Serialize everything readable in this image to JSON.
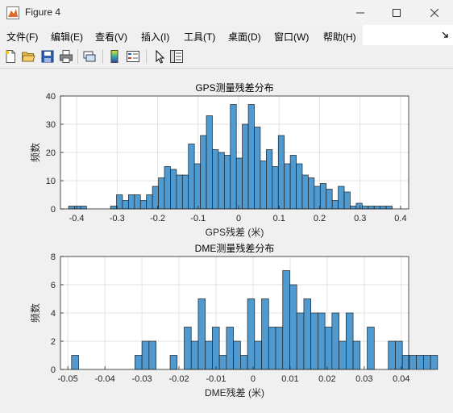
{
  "window": {
    "title": "Figure 4"
  },
  "menu": [
    "文件(F)",
    "编辑(E)",
    "查看(V)",
    "插入(I)",
    "工具(T)",
    "桌面(D)",
    "窗口(W)",
    "帮助(H)"
  ],
  "toolbar": [
    {
      "name": "new-figure-icon"
    },
    {
      "name": "open-file-icon"
    },
    {
      "name": "save-icon"
    },
    {
      "name": "print-icon"
    },
    {
      "name": "link-plot-icon"
    },
    {
      "name": "colorbar-icon"
    },
    {
      "name": "legend-icon"
    },
    {
      "name": "pointer-icon"
    },
    {
      "name": "property-inspector-icon"
    }
  ],
  "colors": {
    "bar_fill": "#4f9bd1",
    "bar_edge": "#1f1f1f",
    "grid": "#e3e3e3",
    "axes": "#262626"
  },
  "chart_data": [
    {
      "type": "bar",
      "title": "GPS测量残差分布",
      "xlabel": "GPS残差 (米)",
      "ylabel": "频数",
      "xlim": [
        -0.44,
        0.42
      ],
      "ylim": [
        0,
        40
      ],
      "grid": true,
      "xticks": [
        "-0.4",
        "-0.3",
        "-0.2",
        "-0.1",
        "0",
        "0.1",
        "0.2",
        "0.3",
        "0.4"
      ],
      "yticks": [
        "0",
        "10",
        "20",
        "30",
        "40"
      ],
      "bin_start": -0.42,
      "bin_width": 0.0148,
      "values": [
        1,
        1,
        1,
        0,
        0,
        0,
        0,
        1,
        5,
        3,
        5,
        5,
        3,
        5,
        8,
        11,
        15,
        14,
        12,
        12,
        23,
        16,
        26,
        33,
        21,
        20,
        19,
        37,
        18,
        30,
        37,
        29,
        17,
        21,
        15,
        26,
        16,
        19,
        16,
        12,
        11,
        8,
        9,
        7,
        3,
        8,
        6,
        1,
        2,
        1,
        1,
        1,
        1,
        1
      ]
    },
    {
      "type": "bar",
      "title": "DME测量残差分布",
      "xlabel": "DME残差 (米)",
      "ylabel": "频数",
      "xlim": [
        -0.052,
        0.042
      ],
      "ylim": [
        0,
        8
      ],
      "grid": true,
      "xticks": [
        "-0.05",
        "-0.04",
        "-0.03",
        "-0.02",
        "-0.01",
        "0",
        "0.01",
        "0.02",
        "0.03",
        "0.04"
      ],
      "yticks": [
        "0",
        "2",
        "4",
        "6",
        "8"
      ],
      "bin_start": -0.049,
      "bin_width": 0.0019,
      "values": [
        1,
        0,
        0,
        0,
        0,
        0,
        0,
        0,
        0,
        1,
        2,
        2,
        0,
        0,
        1,
        0,
        3,
        2,
        5,
        2,
        3,
        1,
        3,
        2,
        1,
        5,
        2,
        5,
        3,
        3,
        7,
        6,
        4,
        5,
        4,
        4,
        3,
        4,
        2,
        4,
        2,
        0,
        3,
        0,
        0,
        2,
        2,
        1,
        1,
        1,
        1,
        1
      ]
    }
  ]
}
